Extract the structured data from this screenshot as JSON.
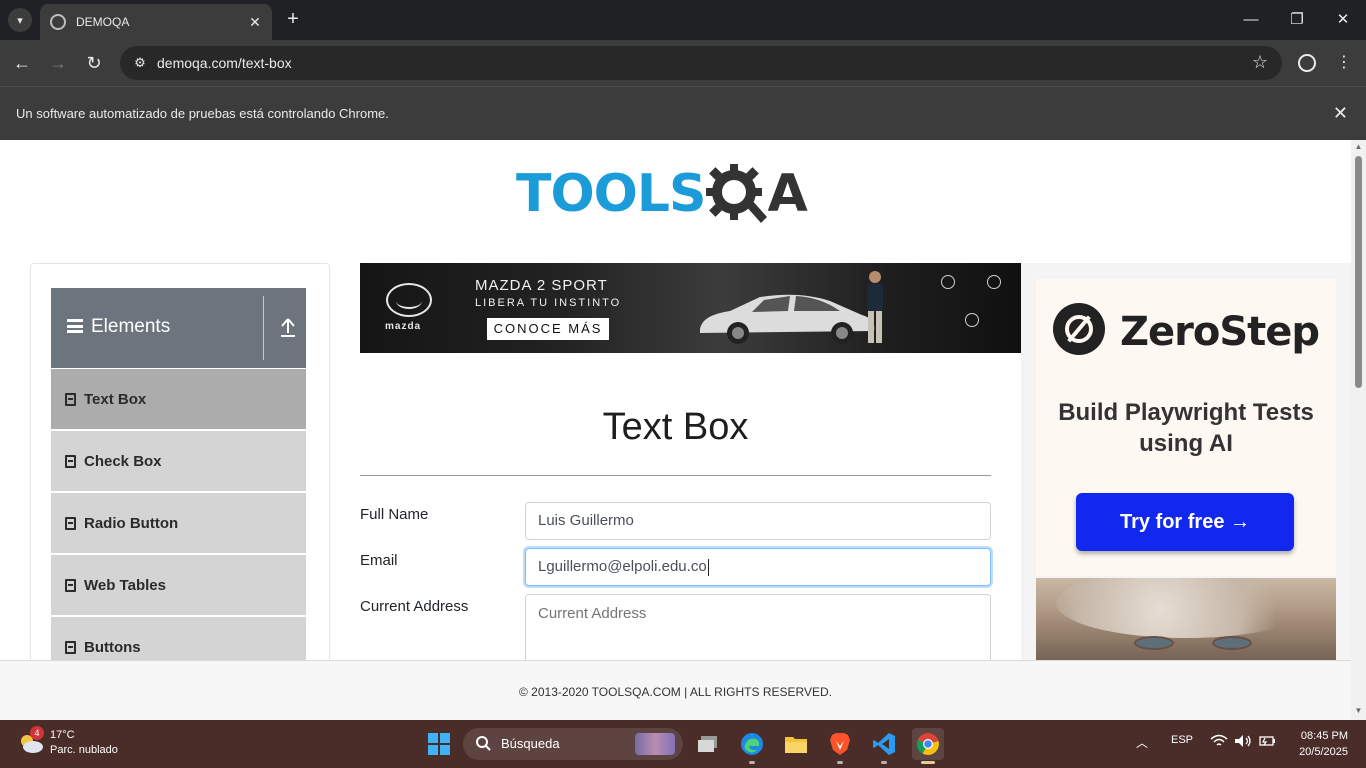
{
  "browser": {
    "tab_title": "DEMOQA",
    "url": "demoqa.com/text-box",
    "infobar_text": "Un software automatizado de pruebas está controlando Chrome."
  },
  "logo": {
    "left_text": "TOOLS",
    "right_text": "A"
  },
  "sidebar": {
    "group_title": "Elements",
    "items": [
      {
        "label": "Text Box",
        "active": true
      },
      {
        "label": "Check Box",
        "active": false
      },
      {
        "label": "Radio Button",
        "active": false
      },
      {
        "label": "Web Tables",
        "active": false
      },
      {
        "label": "Buttons",
        "active": false
      }
    ]
  },
  "ad_mazda": {
    "headline": "MAZDA 2 SPORT",
    "subline": "LIBERA TU INSTINTO",
    "cta": "CONOCE MÁS",
    "brand": "mazda"
  },
  "page": {
    "title": "Text Box"
  },
  "form": {
    "full_name": {
      "label": "Full Name",
      "value": "Luis Guillermo"
    },
    "email": {
      "label": "Email",
      "value": "Lguillermo@elpoli.edu.co"
    },
    "current_address": {
      "label": "Current Address",
      "placeholder": "Current Address"
    }
  },
  "ad_zerostep": {
    "brand": "ZeroStep",
    "tagline": "Build Playwright Tests using AI",
    "cta": "Try for free →"
  },
  "footer": {
    "text": "© 2013-2020 TOOLSQA.COM | ALL RIGHTS RESERVED."
  },
  "taskbar": {
    "weather_badge": "4",
    "weather_temp": "17°C",
    "weather_desc": "Parc. nublado",
    "search_text": "Búsqueda",
    "language": "ESP",
    "time": "08:45 PM",
    "date": "20/5/2025"
  },
  "colors": {
    "tools_blue": "#1b9cd8",
    "sidebar_header": "#6c757d",
    "menu_item": "#d4d4d4",
    "menu_item_active": "#acacac",
    "cta_blue": "#1328ee",
    "taskbar": "#4a2d29"
  }
}
